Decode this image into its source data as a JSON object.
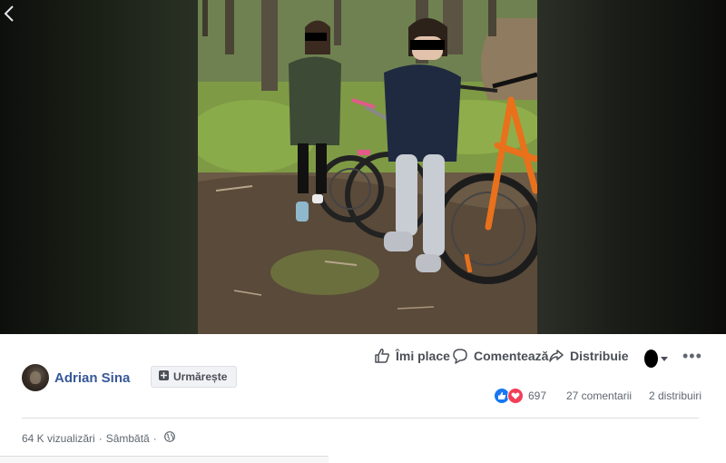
{
  "post": {
    "author_name": "Adrian Sina",
    "follow_label": "Urmărește",
    "views": "64 K vizualizări",
    "separator": "·",
    "date": "Sâmbătă"
  },
  "actions": {
    "like_label": "Îmi place",
    "comment_label": "Comentează",
    "share_label": "Distribuie",
    "more_label": "•••"
  },
  "stats": {
    "reactions_count": "697",
    "comments": "27 comentarii",
    "shares": "2 distribuiri"
  },
  "colors": {
    "link_blue": "#385898",
    "like_blue": "#1877f2",
    "love_red": "#f33e58",
    "text_gray": "#606770"
  },
  "icons": {
    "back": "chevron-left-icon",
    "like": "thumbs-up-icon",
    "comment": "speech-bubble-icon",
    "share": "share-arrow-icon",
    "follow": "follow-plus-icon",
    "globe": "globe-icon"
  }
}
